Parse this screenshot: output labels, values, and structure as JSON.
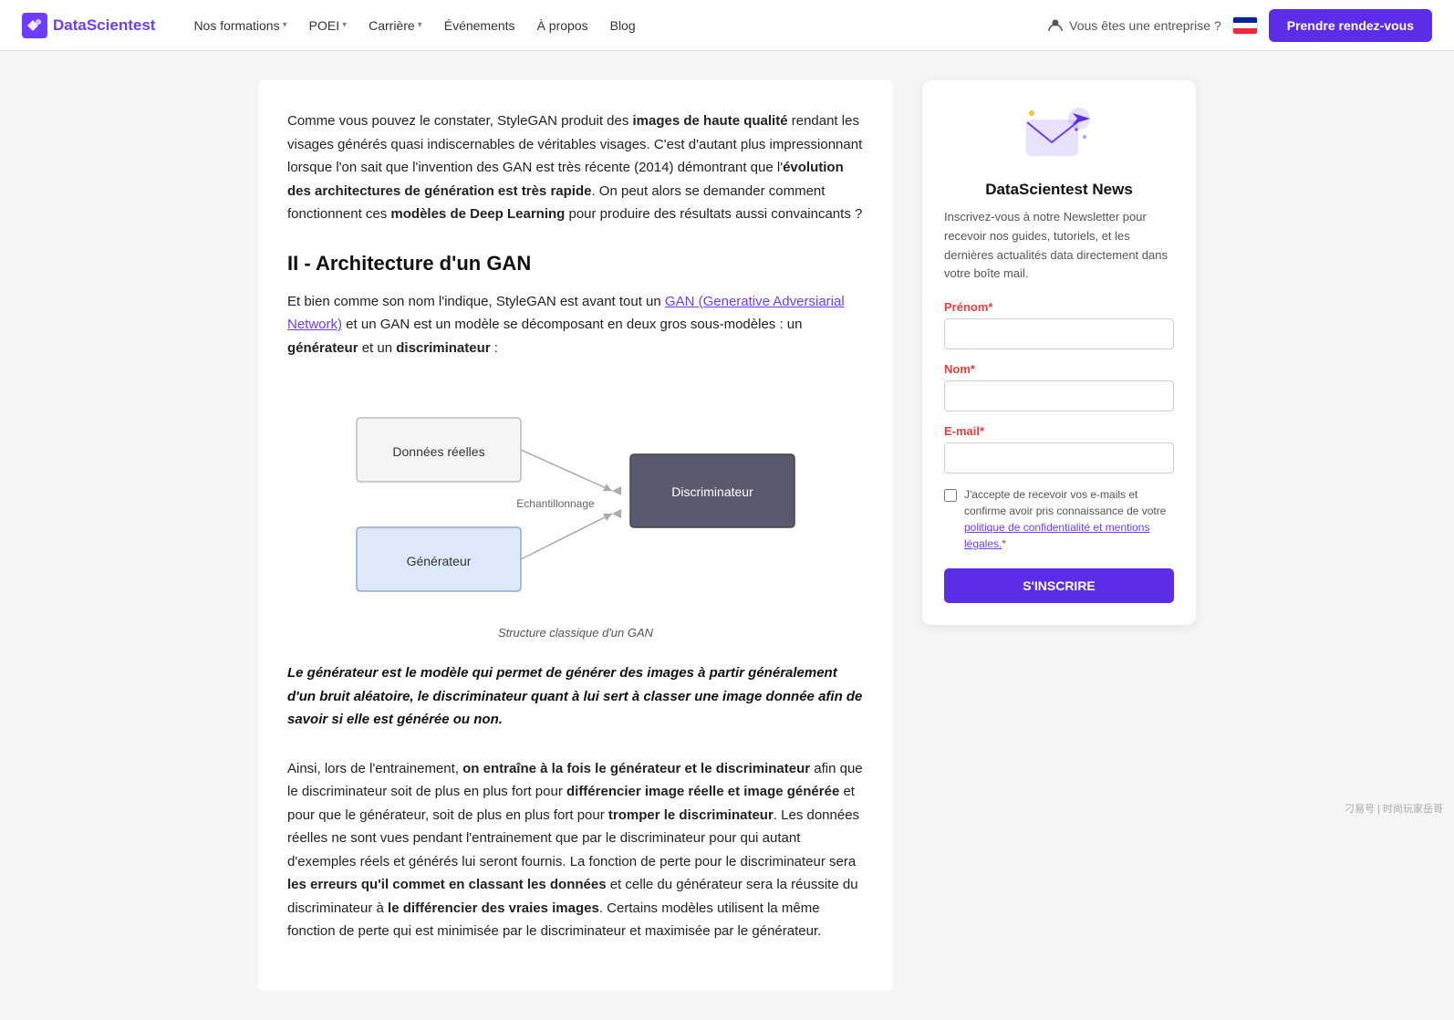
{
  "nav": {
    "logo_text": "DataScientest",
    "links": [
      {
        "label": "Nos formations",
        "has_chevron": true
      },
      {
        "label": "POEI",
        "has_chevron": true
      },
      {
        "label": "Carrière",
        "has_chevron": true
      },
      {
        "label": "Événements",
        "has_chevron": false
      },
      {
        "label": "À propos",
        "has_chevron": false
      },
      {
        "label": "Blog",
        "has_chevron": false
      }
    ],
    "enterprise_label": "Vous êtes une entreprise ?",
    "cta_label": "Prendre rendez-vous"
  },
  "main": {
    "intro_para": "Comme vous pouvez le constater, StyleGAN produit des images de haute qualité rendant les visages générés quasi indiscernables de véritables visages. C'est d'autant plus impressionnant lorsque l'on sait que l'invention des GAN est très récente (2014) démontrant que l'évolution des architectures de génération est très rapide. On peut alors se demander comment fonctionnent ces modèles de Deep Learning pour produire des résultats aussi convaincants ?",
    "section_title": "II - Architecture d'un GAN",
    "section_para": "Et bien comme son nom l'indique, StyleGAN est avant tout un GAN (Generative Adversiarial Network) et un GAN est un modèle se décomposant en deux gros sous-modèles : un générateur et un discriminateur :",
    "link_text": "GAN (Generative Adversiarial Network)",
    "diagram_caption": "Structure classique d'un GAN",
    "key_quote": "Le générateur est le modèle qui permet de générer des images à partir généralement d'un bruit aléatoire, le discriminateur quant à lui sert à classer une image donnée afin de savoir si elle est générée ou non.",
    "body_para": "Ainsi, lors de l'entrainement, on entraîne à la fois le générateur et le discriminateur afin que le discriminateur soit de plus en plus fort pour différencier image réelle et image générée et pour que le générateur, soit de plus en plus fort pour tromper le discriminateur. Les données réelles ne sont vues pendant l'entrainement que par le discriminateur pour qui autant d'exemples réels et générés lui seront fournis. La fonction de perte pour le discriminateur sera les erreurs qu'il commet en classant les données et celle du générateur sera la réussite du discriminateur à le différencier des vraies images. Certains modèles utilisent la même fonction de perte qui est minimisée par le discriminateur et maximisée par le générateur.",
    "diagram": {
      "donnees_label": "Données réelles",
      "generateur_label": "Générateur",
      "echantillonnage_label": "Echantillonnage",
      "discriminateur_label": "Discriminateur"
    }
  },
  "sidebar": {
    "title": "DataScientest News",
    "description": "Inscrivez-vous à notre Newsletter pour recevoir nos guides, tutoriels, et les dernières actualités data directement dans votre boîte mail.",
    "prenom_label": "Prénom",
    "nom_label": "Nom",
    "email_label": "E-mail",
    "checkbox_text": "J'accepte de recevoir vos e-mails et confirme avoir pris connaissance de votre politique de confidentialité et mentions légales.",
    "btn_label": "S'INSCRIRE"
  },
  "watermark": "刁易号 | 时尚玩家岳哥"
}
